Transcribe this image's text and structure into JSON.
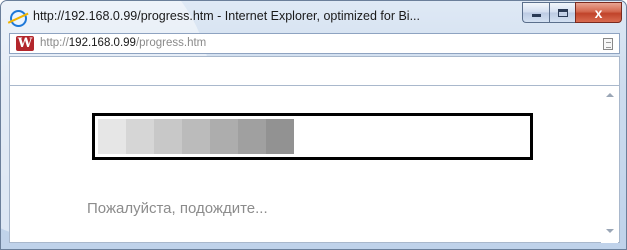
{
  "window": {
    "title": "http://192.168.0.99/progress.htm - Internet Explorer, optimized for Bi...",
    "controls": {
      "minimize": "",
      "maximize": "",
      "close": "x"
    }
  },
  "address": {
    "protocol": "http://",
    "host": "192.168.0.99",
    "path": "/progress.htm",
    "site_icon": "W"
  },
  "progress": {
    "segment_colors": [
      "#e6e6e6",
      "#d6d6d6",
      "#c8c8c8",
      "#bbbbbb",
      "#adadad",
      "#a0a0a0",
      "#929292"
    ]
  },
  "status_text": "Пожалуйста, подождите..."
}
